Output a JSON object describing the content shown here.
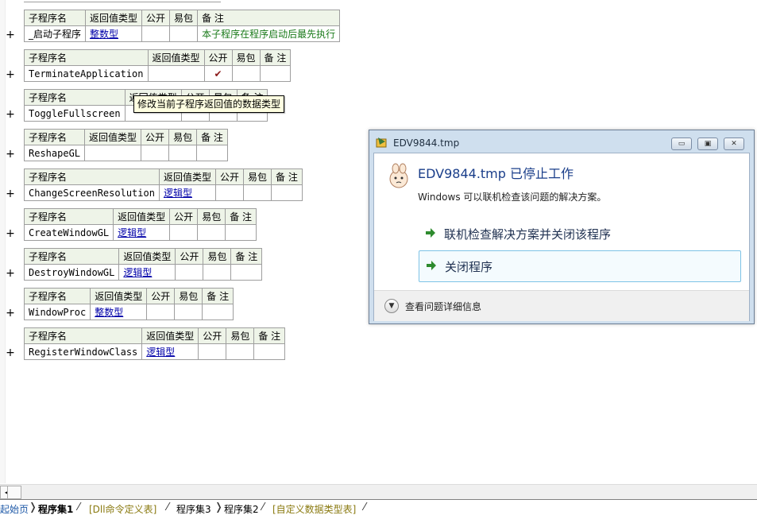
{
  "headers": {
    "name": "子程序名",
    "ret": "返回值类型",
    "public": "公开",
    "easy": "易包",
    "note": "备 注"
  },
  "plus": "+",
  "subroutines": [
    {
      "name": "_启动子程序",
      "ret": "整数型",
      "public": "",
      "easy": "",
      "note": "本子程序在程序启动后最先执行"
    },
    {
      "name": "TerminateApplication",
      "ret": "",
      "public": "✔",
      "easy": "",
      "note": ""
    },
    {
      "name": "ToggleFullscreen",
      "ret": "",
      "public": "",
      "easy": "",
      "note": ""
    },
    {
      "name": "ReshapeGL",
      "ret": "",
      "public": "",
      "easy": "",
      "note": ""
    },
    {
      "name": "ChangeScreenResolution",
      "ret": "逻辑型",
      "public": "",
      "easy": "",
      "note": ""
    },
    {
      "name": "CreateWindowGL",
      "ret": "逻辑型",
      "public": "",
      "easy": "",
      "note": ""
    },
    {
      "name": "DestroyWindowGL",
      "ret": "逻辑型",
      "public": "",
      "easy": "",
      "note": ""
    },
    {
      "name": "WindowProc",
      "ret": "整数型",
      "public": "",
      "easy": "",
      "note": ""
    },
    {
      "name": "RegisterWindowClass",
      "ret": "逻辑型",
      "public": "",
      "easy": "",
      "note": ""
    }
  ],
  "tooltip": "修改当前子程序返回值的数据类型",
  "dialog": {
    "title": "EDV9844.tmp",
    "heading": "EDV9844.tmp 已停止工作",
    "description": "Windows 可以联机检查该问题的解决方案。",
    "options": [
      "联机检查解决方案并关闭该程序",
      "关闭程序"
    ],
    "details": "查看问题详细信息",
    "buttons": {
      "minimize": "▭",
      "restore": "▣",
      "close": "✕"
    }
  },
  "tabs": [
    {
      "label": "起始页",
      "style": "blue"
    },
    {
      "label": "程序集1",
      "style": "active"
    },
    {
      "label": "[Dll命令定义表]",
      "style": "olive"
    },
    {
      "label": "程序集3",
      "style": "normal"
    },
    {
      "label": "程序集2",
      "style": "normal"
    },
    {
      "label": "[自定义数据类型表]",
      "style": "olive"
    }
  ],
  "colors": {
    "header_bg": "#eef4e8",
    "type_text": "#0000a8",
    "note_text": "#1a7a1a",
    "dialog_frame": "#cfdfee",
    "heading_text": "#1a3e8a"
  }
}
